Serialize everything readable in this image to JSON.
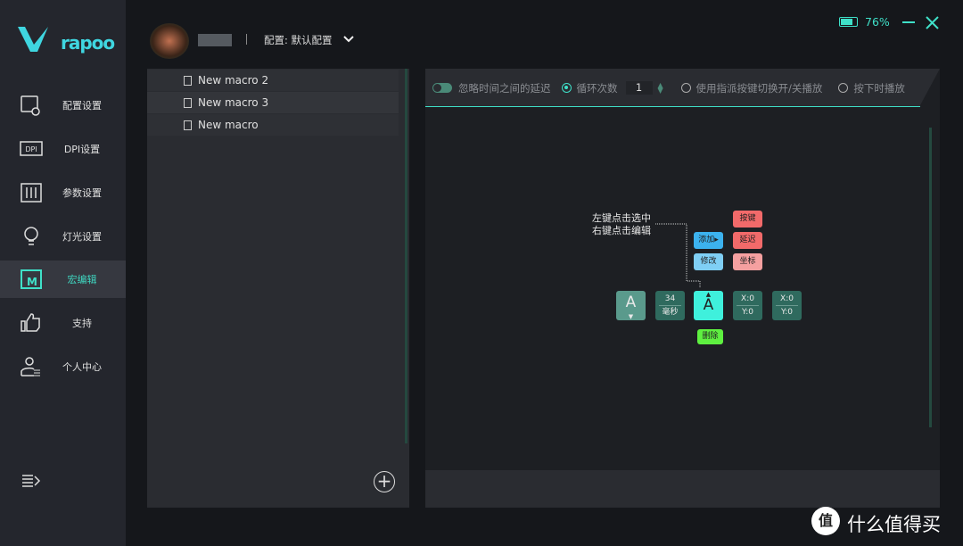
{
  "brand": {
    "name": "rapoo",
    "accent": "#3fe0c8"
  },
  "header": {
    "username": "",
    "profile_label": "配置: 默认配置",
    "battery": "76%"
  },
  "sidebar": {
    "items": [
      {
        "label": "配置设置",
        "icon": "settings-monitor-icon"
      },
      {
        "label": "DPI设置",
        "icon": "dpi-icon"
      },
      {
        "label": "参数设置",
        "icon": "sliders-icon"
      },
      {
        "label": "灯光设置",
        "icon": "bulb-icon"
      },
      {
        "label": "宏编辑",
        "icon": "macro-icon",
        "active": true
      },
      {
        "label": "支持",
        "icon": "thumbs-up-icon"
      },
      {
        "label": "个人中心",
        "icon": "user-icon"
      }
    ]
  },
  "macros": [
    "New macro 2",
    "New macro 3",
    "New macro"
  ],
  "toolbar": {
    "ignore_delay": "忽略时间之间的延迟",
    "loop": "循环次数",
    "loop_count": "1",
    "toggle_play": "使用指派按键切换开/关播放",
    "hold_play": "按下时播放"
  },
  "editor": {
    "hint1": "左键点击选中",
    "hint2": "右键点击编辑",
    "add": "添加▸",
    "modify": "修改",
    "key": "按键",
    "delay": "延迟",
    "coord": "坐标",
    "delete": "删除",
    "blocks": {
      "key1": "A",
      "delay_value": "34",
      "delay_unit": "毫秒",
      "key2": "A",
      "x1": "X:0",
      "y1": "Y:0",
      "x2": "X:0",
      "y2": "Y:0"
    }
  },
  "watermark": "什么值得买"
}
